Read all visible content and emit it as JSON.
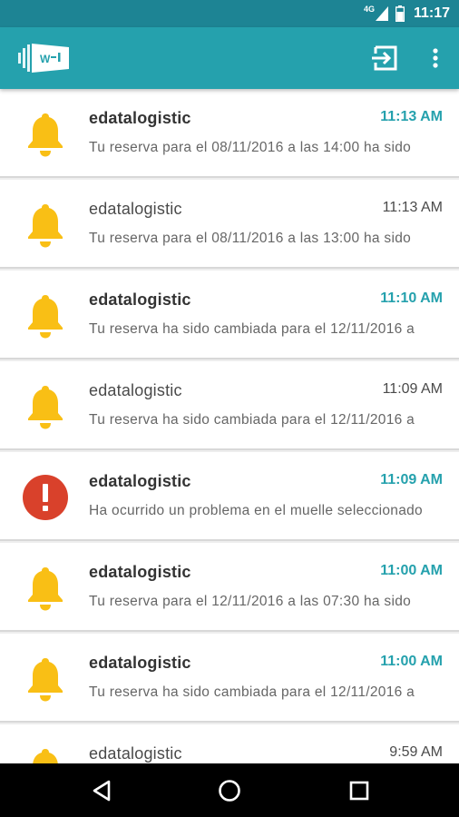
{
  "status_bar": {
    "network": "4G",
    "time": "11:17"
  },
  "app_bar": {
    "logo_text": "W",
    "actions": [
      "logout-icon",
      "more-vert-icon"
    ]
  },
  "colors": {
    "primary": "#25a1ad",
    "primary_dark": "#1d8494",
    "bell": "#f9bf15",
    "error": "#d9412b"
  },
  "notifications": [
    {
      "sender": "edatalogistic",
      "time": "11:13 AM",
      "preview": "Tu reserva para el 08/11/2016 a las 14:00 ha sido",
      "icon": "bell-icon",
      "unread": true
    },
    {
      "sender": "edatalogistic",
      "time": "11:13 AM",
      "preview": "Tu reserva para el 08/11/2016 a las 13:00 ha sido",
      "icon": "bell-icon",
      "unread": false
    },
    {
      "sender": "edatalogistic",
      "time": "11:10 AM",
      "preview": "Tu reserva ha sido cambiada para el 12/11/2016 a",
      "icon": "bell-icon",
      "unread": true
    },
    {
      "sender": "edatalogistic",
      "time": "11:09 AM",
      "preview": "Tu reserva ha sido cambiada para el 12/11/2016 a",
      "icon": "bell-icon",
      "unread": false
    },
    {
      "sender": "edatalogistic",
      "time": "11:09 AM",
      "preview": "Ha ocurrido un problema en el muelle seleccionado",
      "icon": "error-icon",
      "unread": true
    },
    {
      "sender": "edatalogistic",
      "time": "11:00 AM",
      "preview": "Tu reserva para el 12/11/2016 a las 07:30 ha sido",
      "icon": "bell-icon",
      "unread": true
    },
    {
      "sender": "edatalogistic",
      "time": "11:00 AM",
      "preview": "Tu reserva ha sido cambiada para el 12/11/2016 a",
      "icon": "bell-icon",
      "unread": true
    },
    {
      "sender": "edatalogistic",
      "time": "9:59 AM",
      "preview": "",
      "icon": "bell-icon",
      "unread": false
    }
  ],
  "nav_bar": [
    "back-icon",
    "home-icon",
    "recents-icon"
  ]
}
